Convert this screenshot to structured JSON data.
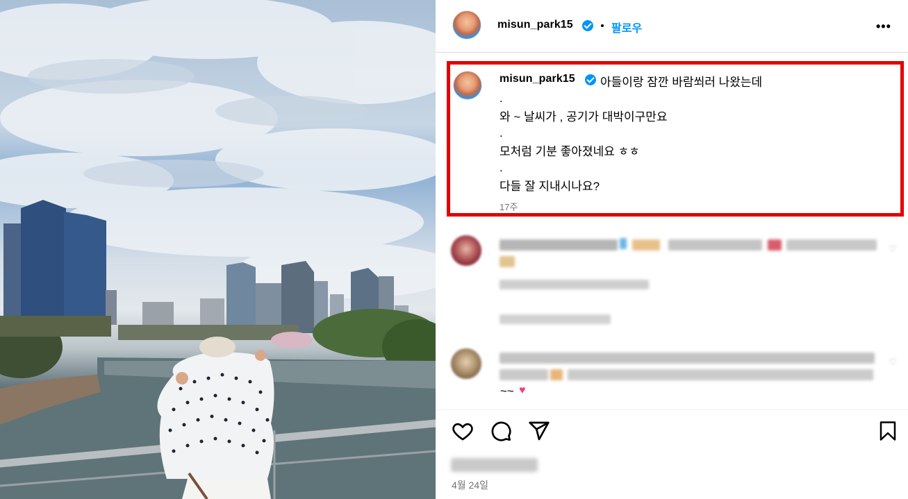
{
  "post": {
    "username": "misun_park15",
    "follow_label": "팔로우",
    "more_label": "•••",
    "caption": {
      "first_line": "아들이랑 잠깐 바람쐬러 나왔는데",
      "lines": [
        ".",
        "와 ~ 날씨가 , 공기가 대박이구만요",
        ".",
        "모처럼 기분 좋아졌네요 ㅎㅎ",
        ".",
        "다들 잘 지내시나요?"
      ],
      "time": "17주"
    },
    "comments": [
      {
        "tail": ""
      },
      {
        "tail": "~~"
      }
    ],
    "date": "4월 24일"
  },
  "icons": [
    "verified-badge-icon",
    "more-options-icon",
    "like-heart-icon",
    "comment-icon",
    "share-icon",
    "save-bookmark-icon",
    "comment-like-heart-icon"
  ],
  "colors": {
    "accent": "#0095f6",
    "highlight_border": "#e30000",
    "muted_text": "#737373"
  }
}
